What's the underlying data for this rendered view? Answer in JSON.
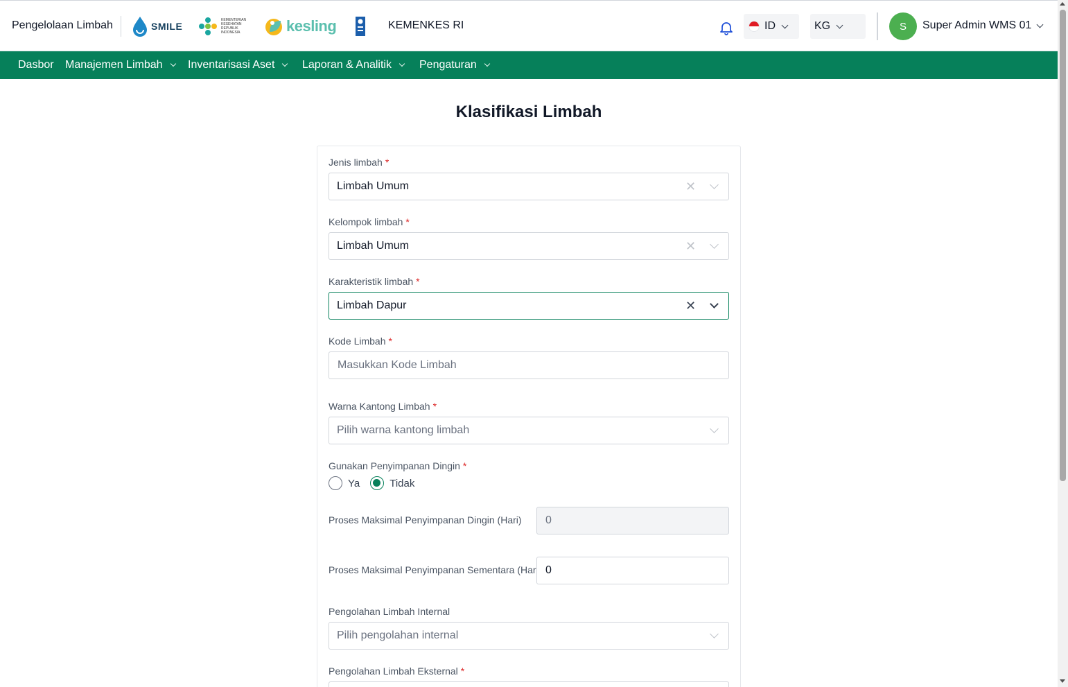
{
  "header": {
    "app_title": "Pengelolaan Limbah",
    "logos": {
      "smile": "SMILE",
      "kemenkes": "KEMENTERIAN KESEHATAN REPUBLIK INDONESIA",
      "kesling": "kesling"
    },
    "org_name": "KEMENKES RI",
    "language": "ID",
    "unit": "KG",
    "user": {
      "initial": "S",
      "name": "Super Admin WMS 01"
    }
  },
  "nav": {
    "items": [
      {
        "label": "Dasbor"
      },
      {
        "label": "Manajemen Limbah"
      },
      {
        "label": "Inventarisasi Aset"
      },
      {
        "label": "Laporan & Analitik"
      },
      {
        "label": "Pengaturan"
      }
    ]
  },
  "page": {
    "title": "Klasifikasi Limbah"
  },
  "form": {
    "required_mark": "*",
    "jenis": {
      "label": "Jenis limbah",
      "value": "Limbah Umum"
    },
    "kelompok": {
      "label": "Kelompok limbah",
      "value": "Limbah Umum"
    },
    "karakteristik": {
      "label": "Karakteristik limbah",
      "value": "Limbah Dapur"
    },
    "kode": {
      "label": "Kode Limbah",
      "placeholder": "Masukkan Kode Limbah"
    },
    "warna": {
      "label": "Warna Kantong Limbah",
      "placeholder": "Pilih warna kantong limbah"
    },
    "dingin": {
      "label": "Gunakan Penyimpanan Dingin",
      "option_yes": "Ya",
      "option_no": "Tidak",
      "selected": "Tidak"
    },
    "max_dingin": {
      "label": "Proses Maksimal Penyimpanan Dingin (Hari)",
      "value": "0"
    },
    "max_sementara": {
      "label": "Proses Maksimal Penyimpanan Sementara (Hari)",
      "value": "0"
    },
    "internal": {
      "label": "Pengolahan Limbah Internal",
      "placeholder": "Pilih pengolahan internal"
    },
    "eksternal": {
      "label": "Pengolahan Limbah Eksternal"
    }
  },
  "colors": {
    "brand_green": "#06805a",
    "avatar_green": "#4caf50",
    "required_red": "#dc2626"
  }
}
